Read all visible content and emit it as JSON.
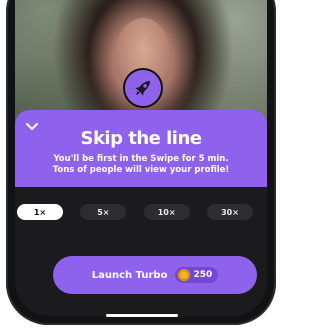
{
  "sheet": {
    "title": "Skip the line",
    "subtitle_line1": "You'll be first in the Swipe for 5 min.",
    "subtitle_line2": "Tons of people will view your profile!",
    "icons": {
      "collapse": "chevron-down-icon",
      "badge": "rocket-icon"
    }
  },
  "multipliers": [
    {
      "label": "1×",
      "selected": true
    },
    {
      "label": "5×",
      "selected": false
    },
    {
      "label": "10×",
      "selected": false
    },
    {
      "label": "30×",
      "selected": false
    }
  ],
  "launch_button": {
    "label": "Launch Turbo",
    "coin_amount": "250",
    "coin_icon": "coin-icon"
  },
  "colors": {
    "accent": "#8f62ee",
    "sheet_bg": "#1b1b1e",
    "coin": "#f4b227"
  }
}
